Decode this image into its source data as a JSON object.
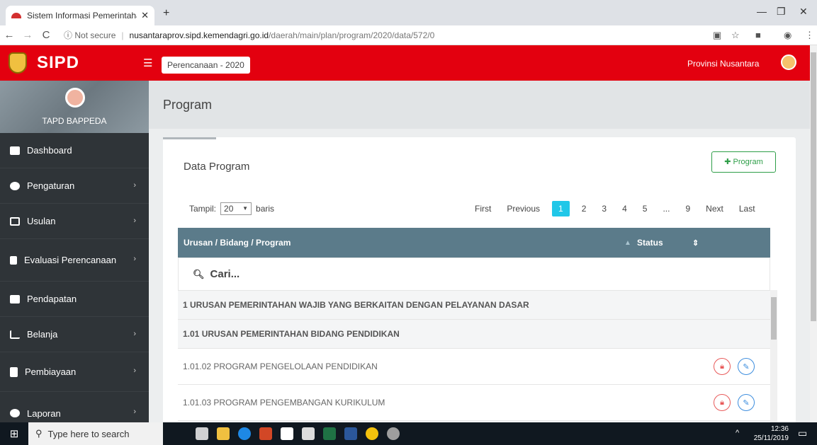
{
  "browser": {
    "tab_title": "Sistem Informasi Pemerintahan D",
    "new_tab": "+",
    "url_security": "Not secure",
    "url_host": "nusantaraprov.sipd.kemendagri.go.id",
    "url_path": "/daerah/main/plan/program/2020/data/572/0"
  },
  "header": {
    "app_name": "SIPD",
    "period": "Perencanaan - 2020",
    "province": "Provinsi Nusantara"
  },
  "sidebar": {
    "role": "TAPD BAPPEDA",
    "items": [
      {
        "label": "Dashboard",
        "has_sub": false
      },
      {
        "label": "Pengaturan",
        "has_sub": true
      },
      {
        "label": "Usulan",
        "has_sub": true
      },
      {
        "label": "Evaluasi Perencanaan",
        "has_sub": true
      },
      {
        "label": "Pendapatan",
        "has_sub": false
      },
      {
        "label": "Belanja",
        "has_sub": true
      },
      {
        "label": "Pembiayaan",
        "has_sub": true
      },
      {
        "label": "Laporan",
        "has_sub": true
      }
    ]
  },
  "page": {
    "title": "Program",
    "card_title": "Data Program",
    "add_button": "Program"
  },
  "table_controls": {
    "show_label": "Tampil:",
    "page_length": "20",
    "rows_label": "baris",
    "pager": [
      "First",
      "Previous",
      "1",
      "2",
      "3",
      "4",
      "5",
      "...",
      "9",
      "Next",
      "Last"
    ],
    "active_page": "1"
  },
  "table": {
    "columns": [
      "Urusan / Bidang / Program",
      "Status"
    ],
    "search_placeholder": "Cari...",
    "rows": [
      {
        "text": "1 URUSAN PEMERINTAHAN WAJIB YANG BERKAITAN DENGAN PELAYANAN DASAR",
        "level": "urusan"
      },
      {
        "text": "1.01 URUSAN PEMERINTAHAN BIDANG PENDIDIKAN",
        "level": "bidang"
      },
      {
        "text": "1.01.02 PROGRAM PENGELOLAAN PENDIDIKAN",
        "level": "program"
      },
      {
        "text": "1.01.03 PROGRAM PENGEMBANGAN KURIKULUM",
        "level": "program"
      }
    ]
  },
  "taskbar": {
    "search_placeholder": "Type here to search",
    "time": "12:36",
    "date": "25/11/2019"
  },
  "colors": {
    "header_red": "#e3000f",
    "sidebar_dark": "#2f3438",
    "table_header": "#5b7b8a",
    "pager_active": "#20c7e8",
    "add_button_green": "#2e9e48"
  }
}
